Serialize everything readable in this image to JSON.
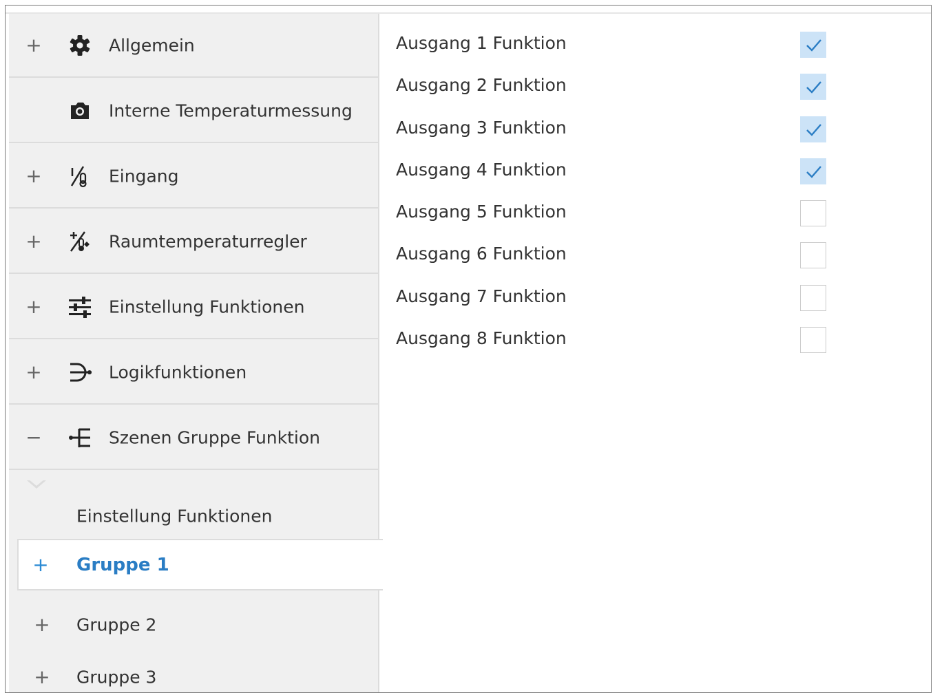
{
  "sidebar": {
    "items": [
      {
        "toggle": "+",
        "icon": "gear-icon",
        "label": "Allgemein"
      },
      {
        "toggle": "",
        "icon": "thermometer-camera-icon",
        "label": "Interne Temperaturmessung"
      },
      {
        "toggle": "+",
        "icon": "sensor-input-icon",
        "label": "Eingang"
      },
      {
        "toggle": "+",
        "icon": "room-thermostat-icon",
        "label": "Raumtemperaturregler"
      },
      {
        "toggle": "+",
        "icon": "sliders-icon",
        "label": "Einstellung Funktionen"
      },
      {
        "toggle": "+",
        "icon": "logic-gate-icon",
        "label": "Logikfunktionen"
      },
      {
        "toggle": "−",
        "icon": "scene-tree-icon",
        "label": "Szenen Gruppe Funktion"
      }
    ],
    "sub_items": [
      {
        "toggle": "",
        "label": "Einstellung Funktionen"
      },
      {
        "toggle": "+",
        "label": "Gruppe 1",
        "active": true
      },
      {
        "toggle": "+",
        "label": "Gruppe 2"
      },
      {
        "toggle": "+",
        "label": "Gruppe 3"
      }
    ]
  },
  "main": {
    "rows": [
      {
        "label": "Ausgang 1 Funktion",
        "checked": true
      },
      {
        "label": "Ausgang 2 Funktion",
        "checked": true
      },
      {
        "label": "Ausgang 3 Funktion",
        "checked": true
      },
      {
        "label": "Ausgang 4 Funktion",
        "checked": true
      },
      {
        "label": "Ausgang 5 Funktion",
        "checked": false
      },
      {
        "label": "Ausgang 6 Funktion",
        "checked": false
      },
      {
        "label": "Ausgang 7 Funktion",
        "checked": false
      },
      {
        "label": "Ausgang 8 Funktion",
        "checked": false
      }
    ]
  },
  "colors": {
    "accent": "#2a7dc4",
    "checkbox_checked_bg": "#cce3f7",
    "sidebar_bg": "#f0f0f0"
  }
}
